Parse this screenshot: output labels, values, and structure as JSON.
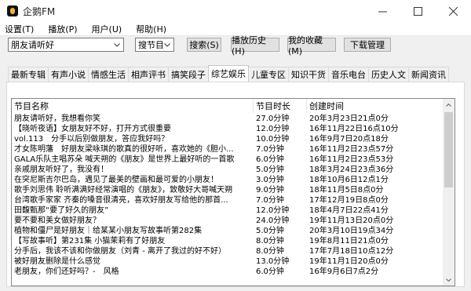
{
  "window": {
    "title": "企鹅FM"
  },
  "menu": [
    "设置(T)",
    "播放(P)",
    "用户(U)",
    "帮助(H)"
  ],
  "toolbar": {
    "search_value": "朋友请听好",
    "search_type": "搜节目",
    "search_button": "搜索(S)",
    "history_button": "播放历史(H)",
    "favorites_button": "我的收藏(M)",
    "download_button": "下载管理"
  },
  "tabs": [
    {
      "label": "最新专辑",
      "active": false
    },
    {
      "label": "有声小说",
      "active": false
    },
    {
      "label": "情感生活",
      "active": false
    },
    {
      "label": "相声评书",
      "active": false
    },
    {
      "label": "搞笑段子",
      "active": false
    },
    {
      "label": "综艺娱乐",
      "active": true
    },
    {
      "label": "儿童专区",
      "active": false
    },
    {
      "label": "知识干货",
      "active": false
    },
    {
      "label": "音乐电台",
      "active": false
    },
    {
      "label": "历史人文",
      "active": false
    },
    {
      "label": "新闻资讯",
      "active": false
    }
  ],
  "table": {
    "columns": [
      "节目名称",
      "节目时长",
      "创建时间"
    ],
    "rows": [
      [
        "朋友请听好，我想看你笑",
        "27.0分钟",
        "20年3月23日21点0分"
      ],
      [
        "【晓听夜语】女朋友好不好，打开方式很重要",
        "12.0分钟",
        "16年11月22日16点10分"
      ],
      [
        "vol.113　分手以后别做朋友，答应我好吗？",
        "10.0分钟",
        "16年9月7日20点18分"
      ],
      [
        "才女陈明藩　好朋友梁咏琪的歌真的很好听，喜欢她的《胆小...",
        "7.0分钟",
        "16年11月2日23点57分"
      ],
      [
        "GALA乐队主唱苏朵 喊天朔的《朋友》是世界上最好听的一首歌",
        "6.0分钟",
        "16年11月2日23点53分"
      ],
      [
        "亲戚朋友听好了，我没有！",
        "5.0分钟",
        "18年3月24日23点36分"
      ],
      [
        "在突尼斯吉尔巴岛，遇见了最美的壁画和最可爱的小朋友！",
        "3.0分钟",
        "18年10月6日12点1分"
      ],
      [
        "歌手刘思伟 聆听满满好经常演唱的《朋友》，致敬好大哥喊天朔",
        "9.0分钟",
        "18年11月5日8点0分"
      ],
      [
        "台湾歌手家家 齐秦的嗓音很清亮，喜欢好朋友写给他的那首...",
        "7.0分钟",
        "17年12月19日8点0分"
      ],
      [
        "田馥甄那“要了好久的朋友”",
        "12.0分钟",
        "18年4月7日22点41分"
      ],
      [
        "要不要和美女做好朋友？",
        "24.0分钟",
        "19年11月13日20点0分"
      ],
      [
        "植物和僵尸是好朋友｜给某某小朋友写故事听第282集",
        "5.0分钟",
        "20年3月10日19点34分"
      ],
      [
        "【写故事听】第231集 小猫茉莉有了好朋友",
        "8.0分钟",
        "19年8月11日21点0分"
      ],
      [
        "分手后，我该不该和你做朋友（刘青 - 离开了我过的好不好）",
        "8.0分钟",
        "17年7月18日10点12分"
      ],
      [
        "被好朋友删除是什么感觉",
        "13.0分钟",
        "19年11月1日20点0分"
      ],
      [
        "老朋友，你们还好吗？-　风格",
        "6.0分钟",
        "16年9月6日7点2分"
      ]
    ]
  },
  "icons": {
    "app": "penguin-fm-logo-icon",
    "minimize": "minimize-icon",
    "maximize": "maximize-icon",
    "close": "close-icon",
    "dropdown": "chevron-down-icon"
  }
}
